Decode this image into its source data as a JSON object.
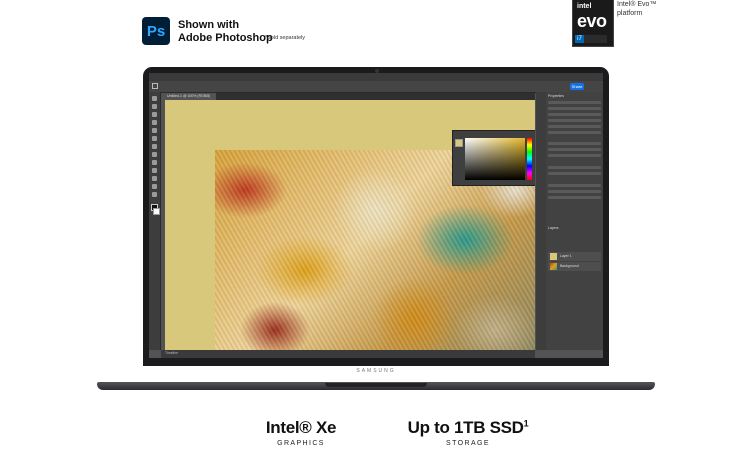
{
  "header": {
    "ps_logo_text": "Ps",
    "shown_with": "Shown with",
    "app_name": "Adobe Photoshop",
    "sold_separately": "*Sold separately"
  },
  "evo_badge": {
    "intel": "intel",
    "evo": "evo",
    "tier": "i7",
    "caption_line1": "Intel® Evo™",
    "caption_line2": "platform"
  },
  "laptop": {
    "brand": "SAMSUNG"
  },
  "photoshop": {
    "share_label": "Share",
    "doc_tab": "Untitled-1 @ 100% (RGB/8)",
    "status_text": "Timeline",
    "panel_heads": [
      "Properties",
      "Layers"
    ],
    "layers": [
      {
        "name": "Layer 1"
      },
      {
        "name": "Background"
      }
    ]
  },
  "specs": [
    {
      "title": "Intel® Xe",
      "subtitle": "GRAPHICS"
    },
    {
      "title": "Up to 1TB SSD",
      "sup": "1",
      "subtitle": "STORAGE"
    }
  ]
}
